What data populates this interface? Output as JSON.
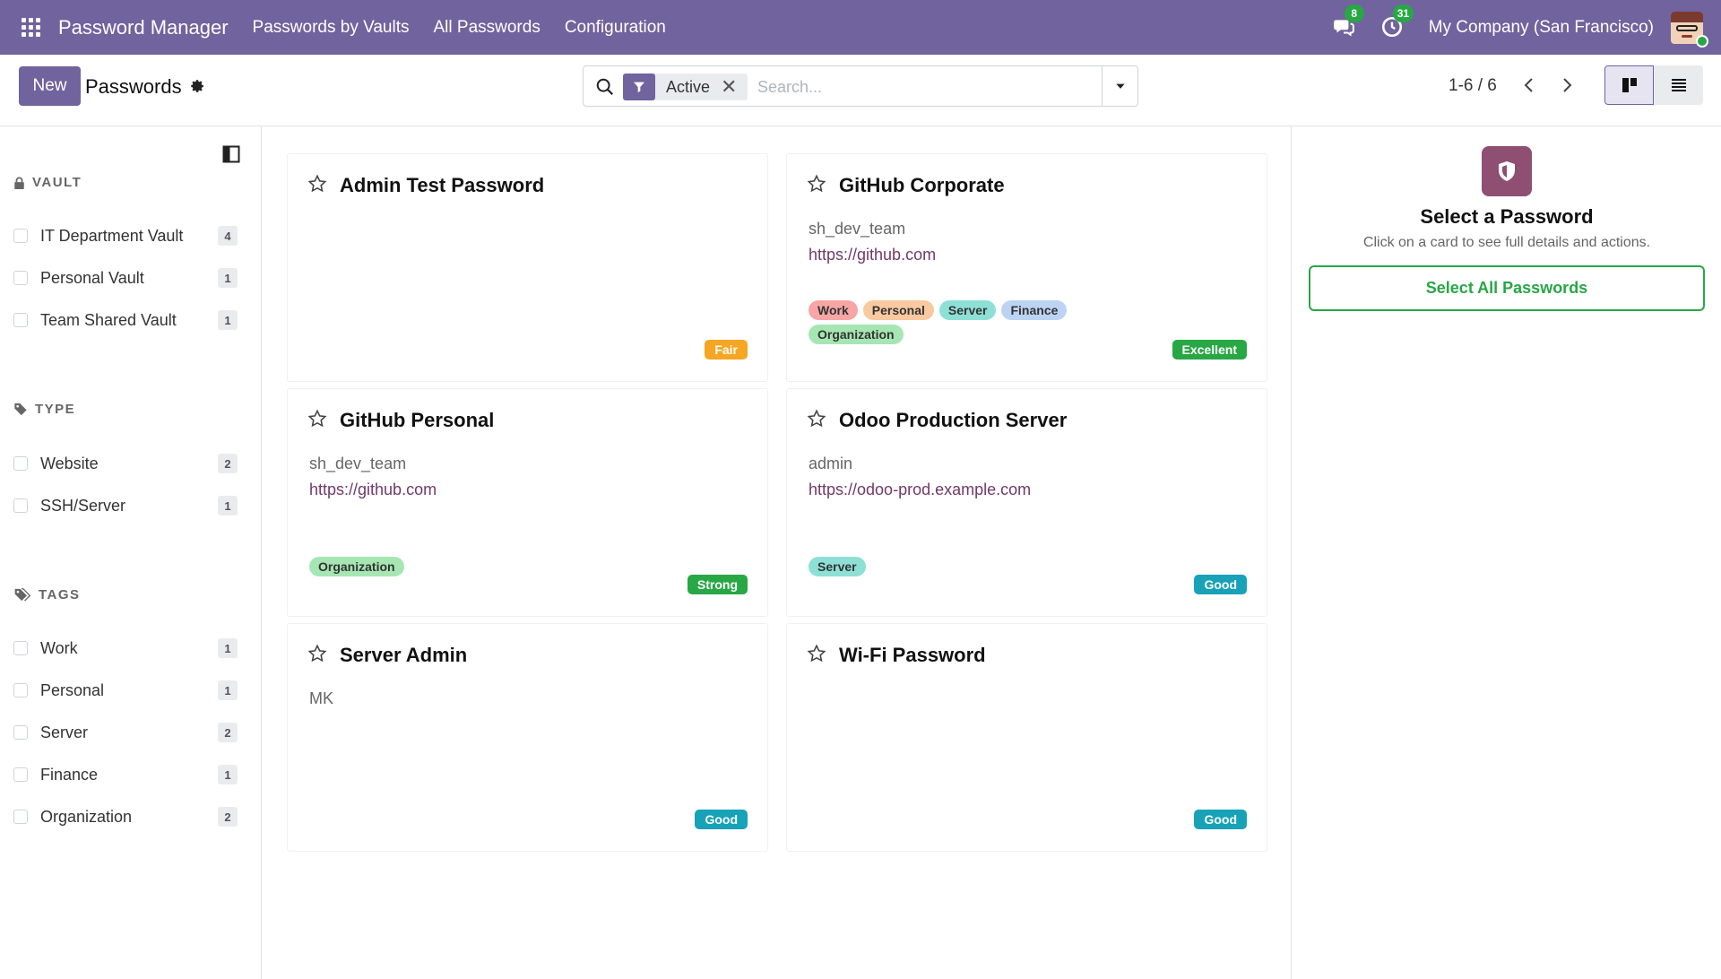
{
  "navbar": {
    "brand": "Password Manager",
    "menu": [
      "Passwords by Vaults",
      "All Passwords",
      "Configuration"
    ],
    "messages_count": "8",
    "activities_count": "31",
    "company": "My Company (San Francisco)"
  },
  "control_panel": {
    "new_label": "New",
    "title": "Passwords",
    "filter_facet": "Active",
    "search_placeholder": "Search...",
    "pager": "1-6 / 6"
  },
  "sidebar": {
    "vault_header": "VAULT",
    "vaults": [
      {
        "label": "IT Department Vault",
        "count": "4"
      },
      {
        "label": "Personal Vault",
        "count": "1"
      },
      {
        "label": "Team Shared Vault",
        "count": "1"
      }
    ],
    "type_header": "TYPE",
    "types": [
      {
        "label": "Website",
        "count": "2"
      },
      {
        "label": "SSH/Server",
        "count": "1"
      }
    ],
    "tags_header": "TAGS",
    "tags": [
      {
        "label": "Work",
        "count": "1"
      },
      {
        "label": "Personal",
        "count": "1"
      },
      {
        "label": "Server",
        "count": "2"
      },
      {
        "label": "Finance",
        "count": "1"
      },
      {
        "label": "Organization",
        "count": "2"
      }
    ]
  },
  "cards": [
    {
      "title": "Admin Test Password",
      "user": "",
      "url": "",
      "tags": [],
      "strength": "Fair"
    },
    {
      "title": "GitHub Corporate",
      "user": "sh_dev_team",
      "url": "https://github.com",
      "tags": [
        "Work",
        "Personal",
        "Server",
        "Finance",
        "Organization"
      ],
      "strength": "Excellent"
    },
    {
      "title": "GitHub Personal",
      "user": "sh_dev_team",
      "url": "https://github.com",
      "tags": [
        "Organization"
      ],
      "strength": "Strong"
    },
    {
      "title": "Odoo Production Server",
      "user": "admin",
      "url": "https://odoo-prod.example.com",
      "tags": [
        "Server"
      ],
      "strength": "Good"
    },
    {
      "title": "Server Admin",
      "user": "MK",
      "url": "",
      "tags": [],
      "strength": "Good"
    },
    {
      "title": "Wi-Fi Password",
      "user": "",
      "url": "",
      "tags": [],
      "strength": "Good"
    }
  ],
  "tag_colors": {
    "Work": "#f8a5a5",
    "Personal": "#f9c9a0",
    "Server": "#8ee0d6",
    "Finance": "#bcd3f3",
    "Organization": "#a6e6b3"
  },
  "strength_colors": {
    "Fair": "#f5a623",
    "Excellent": "#28a745",
    "Strong": "#28a745",
    "Good": "#17a2b8"
  },
  "right_panel": {
    "title": "Select a Password",
    "subtitle": "Click on a card to see full details and actions.",
    "button_label": "Select All Passwords"
  },
  "colors": {
    "brand": "#71639e",
    "link": "#71396b",
    "success": "#28a745"
  }
}
